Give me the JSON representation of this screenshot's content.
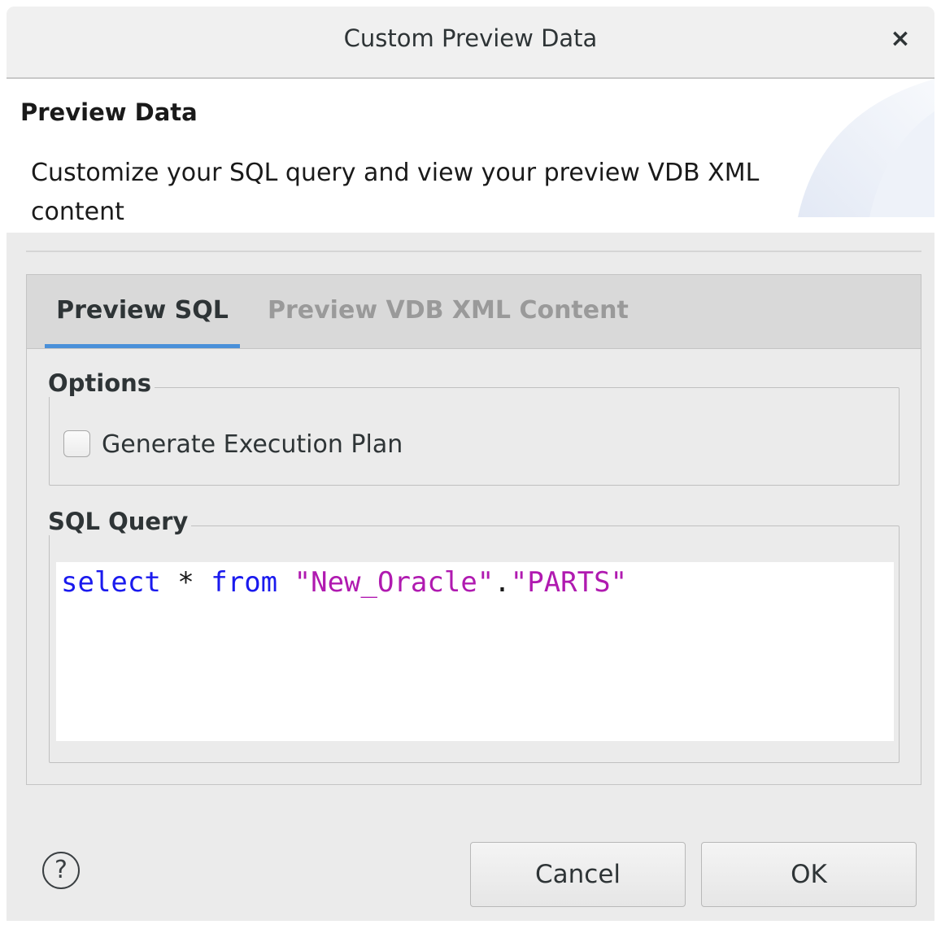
{
  "window": {
    "title": "Custom Preview Data",
    "close_glyph": "×"
  },
  "header": {
    "title": "Preview Data",
    "description": "Customize your SQL query and view your preview VDB XML content"
  },
  "tabs": [
    {
      "label": "Preview SQL",
      "active": true
    },
    {
      "label": "Preview VDB XML Content",
      "active": false
    }
  ],
  "options": {
    "group_label": "Options",
    "generate_execution_plan": {
      "label": "Generate Execution Plan",
      "checked": false
    }
  },
  "sql_query": {
    "group_label": "SQL Query",
    "tokens": {
      "select": "select",
      "star": " * ",
      "from": "from",
      "space": " ",
      "schema": "\"New_Oracle\"",
      "dot": ".",
      "table": "\"PARTS\""
    }
  },
  "footer": {
    "help_glyph": "?",
    "cancel_label": "Cancel",
    "ok_label": "OK"
  },
  "colors": {
    "accent": "#4a90d9",
    "keyword": "#1a1aee",
    "string": "#b01ab0"
  }
}
